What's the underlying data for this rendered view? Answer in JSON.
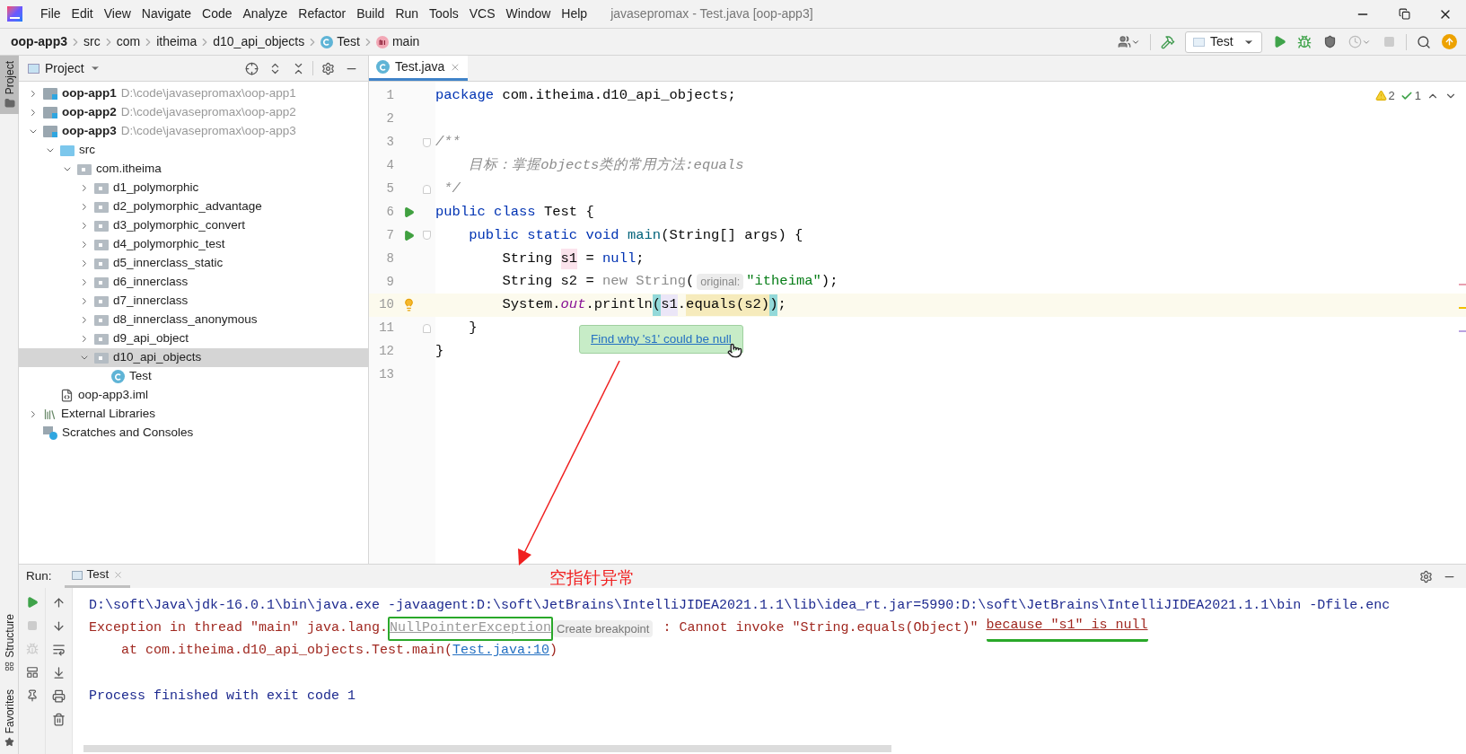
{
  "menu": {
    "items": [
      "File",
      "Edit",
      "View",
      "Navigate",
      "Code",
      "Analyze",
      "Refactor",
      "Build",
      "Run",
      "Tools",
      "VCS",
      "Window",
      "Help"
    ],
    "title": "javasepromax - Test.java [oop-app3]"
  },
  "breadcrumbs": [
    {
      "label": "oop-app3",
      "kind": "module"
    },
    {
      "label": "src",
      "kind": "folder"
    },
    {
      "label": "com",
      "kind": "folder"
    },
    {
      "label": "itheima",
      "kind": "folder"
    },
    {
      "label": "d10_api_objects",
      "kind": "folder"
    },
    {
      "label": "Test",
      "kind": "class"
    },
    {
      "label": "main",
      "kind": "method"
    }
  ],
  "toolbar": {
    "run_config": "Test"
  },
  "side_tabs": [
    {
      "label": "Project",
      "selected": true
    }
  ],
  "bottom_side_tabs": [
    {
      "label": "Structure"
    },
    {
      "label": "Favorites"
    }
  ],
  "project": {
    "title": "Project",
    "tree": [
      {
        "label": "oop-app1",
        "path": "D:\\code\\javasepromax\\oop-app1",
        "kind": "module",
        "expanded": false,
        "selected": false
      },
      {
        "label": "oop-app2",
        "path": "D:\\code\\javasepromax\\oop-app2",
        "kind": "module",
        "expanded": false,
        "selected": false
      },
      {
        "label": "oop-app3",
        "path": "D:\\code\\javasepromax\\oop-app3",
        "kind": "module",
        "expanded": true,
        "selected": false,
        "children": [
          {
            "label": "src",
            "kind": "source",
            "expanded": true,
            "selected": false,
            "children": [
              {
                "label": "com.itheima",
                "kind": "package",
                "expanded": true,
                "selected": false,
                "children": [
                  {
                    "label": "d1_polymorphic",
                    "kind": "package",
                    "expanded": false,
                    "selected": false
                  },
                  {
                    "label": "d2_polymorphic_advantage",
                    "kind": "package",
                    "expanded": false,
                    "selected": false
                  },
                  {
                    "label": "d3_polymorphic_convert",
                    "kind": "package",
                    "expanded": false,
                    "selected": false
                  },
                  {
                    "label": "d4_polymorphic_test",
                    "kind": "package",
                    "expanded": false,
                    "selected": false
                  },
                  {
                    "label": "d5_innerclass_static",
                    "kind": "package",
                    "expanded": false,
                    "selected": false
                  },
                  {
                    "label": "d6_innerclass",
                    "kind": "package",
                    "expanded": false,
                    "selected": false
                  },
                  {
                    "label": "d7_innerclass",
                    "kind": "package",
                    "expanded": false,
                    "selected": false
                  },
                  {
                    "label": "d8_innerclass_anonymous",
                    "kind": "package",
                    "expanded": false,
                    "selected": false
                  },
                  {
                    "label": "d9_api_object",
                    "kind": "package",
                    "expanded": false,
                    "selected": false
                  },
                  {
                    "label": "d10_api_objects",
                    "kind": "package",
                    "expanded": true,
                    "selected": true,
                    "children": [
                      {
                        "label": "Test",
                        "kind": "class",
                        "selected": false
                      }
                    ]
                  }
                ]
              }
            ]
          },
          {
            "label": "oop-app3.iml",
            "kind": "iml",
            "selected": false
          }
        ]
      },
      {
        "label": "External Libraries",
        "kind": "libraries",
        "expanded": false,
        "selected": false
      },
      {
        "label": "Scratches and Consoles",
        "kind": "scratches",
        "selected": false
      }
    ]
  },
  "editor": {
    "tab": "Test.java",
    "warnings": "2",
    "weak_warnings": "1",
    "lines": [
      {
        "number": "1",
        "current": false,
        "run_marker": false,
        "bulb": false,
        "fold_start": false,
        "fold_end": false,
        "segments": [
          {
            "text": "package ",
            "kind": "keyword"
          },
          {
            "text": "com.itheima.d10_api_objects;",
            "kind": "plain"
          }
        ]
      },
      {
        "number": "2",
        "current": false,
        "run_marker": false,
        "bulb": false,
        "fold_start": false,
        "fold_end": false
      },
      {
        "number": "3",
        "current": false,
        "run_marker": false,
        "bulb": false,
        "fold_start": true,
        "fold_end": false,
        "segments": [
          {
            "text": "/**",
            "kind": "comment"
          }
        ]
      },
      {
        "number": "4",
        "current": false,
        "run_marker": false,
        "bulb": false,
        "fold_start": false,
        "fold_end": false,
        "segments": [
          {
            "text": "    目标：掌握objects类的常用方法:equals",
            "kind": "comment"
          }
        ]
      },
      {
        "number": "5",
        "current": false,
        "run_marker": false,
        "bulb": false,
        "fold_start": false,
        "fold_end": true,
        "segments": [
          {
            "text": " */",
            "kind": "comment"
          }
        ]
      },
      {
        "number": "6",
        "current": false,
        "run_marker": true,
        "bulb": false,
        "fold_start": false,
        "fold_end": false,
        "segments": [
          {
            "text": "public class ",
            "kind": "keyword"
          },
          {
            "text": "Test {",
            "kind": "plain"
          }
        ]
      },
      {
        "number": "7",
        "current": false,
        "run_marker": true,
        "bulb": false,
        "fold_start": true,
        "fold_end": false,
        "segments": [
          {
            "text": "    public static void ",
            "kind": "keyword"
          },
          {
            "text": "main",
            "kind": "method"
          },
          {
            "text": "(String[] args) {",
            "kind": "plain"
          }
        ]
      },
      {
        "number": "8",
        "current": false,
        "run_marker": false,
        "bulb": false,
        "fold_start": false,
        "fold_end": false,
        "segments": [
          {
            "text": "        String ",
            "kind": "plain"
          },
          {
            "text": "s1",
            "kind": "write-highlight"
          },
          {
            "text": " = ",
            "kind": "plain"
          },
          {
            "text": "null",
            "kind": "keyword"
          },
          {
            "text": ";",
            "kind": "plain"
          }
        ]
      },
      {
        "number": "9",
        "current": false,
        "run_marker": false,
        "bulb": false,
        "fold_start": false,
        "fold_end": false,
        "segments": [
          {
            "text": "        String s2 = ",
            "kind": "plain"
          },
          {
            "text": "new String",
            "kind": "faded"
          },
          {
            "text": "(",
            "kind": "plain"
          },
          {
            "text": "original:",
            "kind": "hint"
          },
          {
            "text": "\"itheima\"",
            "kind": "string"
          },
          {
            "text": ");",
            "kind": "plain"
          }
        ]
      },
      {
        "number": "10",
        "current": true,
        "run_marker": false,
        "bulb": true,
        "fold_start": false,
        "fold_end": false,
        "segments": [
          {
            "text": "        System.",
            "kind": "plain"
          },
          {
            "text": "out",
            "kind": "field"
          },
          {
            "text": ".println",
            "kind": "plain"
          },
          {
            "text": "(",
            "kind": "brace-match"
          },
          {
            "text": "s1",
            "kind": "read-highlight"
          },
          {
            "text": ".",
            "kind": "plain"
          },
          {
            "text": "equals",
            "kind": "warn-highlight"
          },
          {
            "text": "(s2)",
            "kind": "warn-highlight"
          },
          {
            "text": ")",
            "kind": "brace-match"
          },
          {
            "text": ";",
            "kind": "plain"
          }
        ]
      },
      {
        "number": "11",
        "current": false,
        "run_marker": false,
        "bulb": false,
        "fold_start": false,
        "fold_end": true,
        "segments": [
          {
            "text": "    }",
            "kind": "plain"
          }
        ]
      },
      {
        "number": "12",
        "current": false,
        "run_marker": false,
        "bulb": false,
        "fold_start": false,
        "fold_end": false,
        "segments": [
          {
            "text": "}",
            "kind": "plain"
          }
        ]
      },
      {
        "number": "13",
        "current": false,
        "run_marker": false,
        "bulb": false,
        "fold_start": false,
        "fold_end": false
      }
    ],
    "tooltip": "Find why 's1' could be null"
  },
  "annotation": "空指针异常",
  "run": {
    "label": "Run:",
    "tab": "Test",
    "console": [
      {
        "kind": "command",
        "segments": [
          {
            "text": "D:\\soft\\Java\\jdk-16.0.1\\bin\\java.exe -javaagent:D:\\soft\\JetBrains\\IntelliJIDEA2021.1.1\\lib\\idea_rt.jar=5990:D:\\soft\\JetBrains\\IntelliJIDEA2021.1.1\\bin -Dfile.enc",
            "kind": "text"
          }
        ]
      },
      {
        "kind": "error",
        "segments": [
          {
            "text": "Exception in thread \"main\" java.lang.",
            "kind": "text"
          },
          {
            "text": "NullPointerException",
            "kind": "boxed-link"
          },
          {
            "text": "Create breakpoint",
            "kind": "pill"
          },
          {
            "text": " : Cannot invoke \"String.equals(Object)\" ",
            "kind": "text"
          },
          {
            "text": "because \"s1\" is null",
            "kind": "underlined"
          }
        ]
      },
      {
        "kind": "error",
        "segments": [
          {
            "text": "    at com.itheima.d10_api_objects.Test.main(",
            "kind": "text"
          },
          {
            "text": "Test.java:10",
            "kind": "link"
          },
          {
            "text": ")",
            "kind": "text"
          }
        ]
      },
      {
        "kind": "exit",
        "segments": [
          {
            "text": "Process finished with exit code 1",
            "kind": "text"
          }
        ]
      }
    ]
  }
}
